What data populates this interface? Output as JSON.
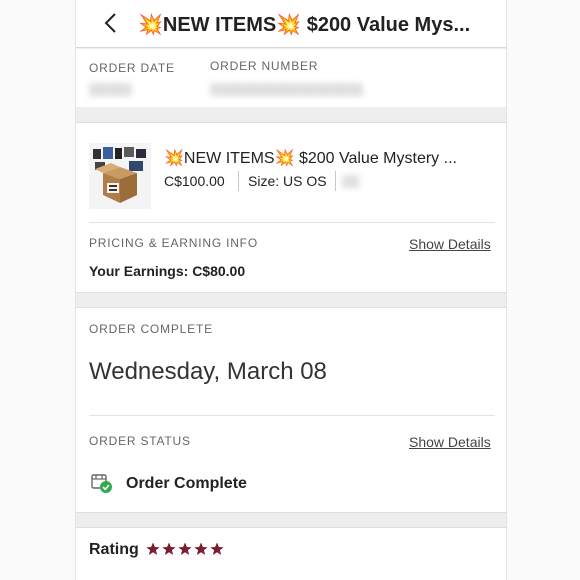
{
  "header": {
    "title": "💥NEW ITEMS💥 $200 Value Mys..."
  },
  "order_info": {
    "date_label": "ORDER DATE",
    "number_label": "ORDER NUMBER"
  },
  "item": {
    "title": "💥NEW ITEMS💥 $200 Value Mystery ...",
    "price": "C$100.00",
    "size": "Size: US OS",
    "thumbnail_icon": "mystery-box-image"
  },
  "pricing": {
    "label": "PRICING & EARNING INFO",
    "show_details": "Show Details",
    "earnings": "Your Earnings: C$80.00"
  },
  "completion": {
    "label": "ORDER COMPLETE",
    "date": "Wednesday, March 08"
  },
  "status": {
    "label": "ORDER STATUS",
    "show_details": "Show Details",
    "value": "Order Complete",
    "icon": "package-check-icon"
  },
  "rating": {
    "label": "Rating",
    "stars": 5,
    "star_color": "#7b1f2e"
  },
  "colors": {
    "accent": "#7b1f2e",
    "check_green": "#2eab4f"
  }
}
